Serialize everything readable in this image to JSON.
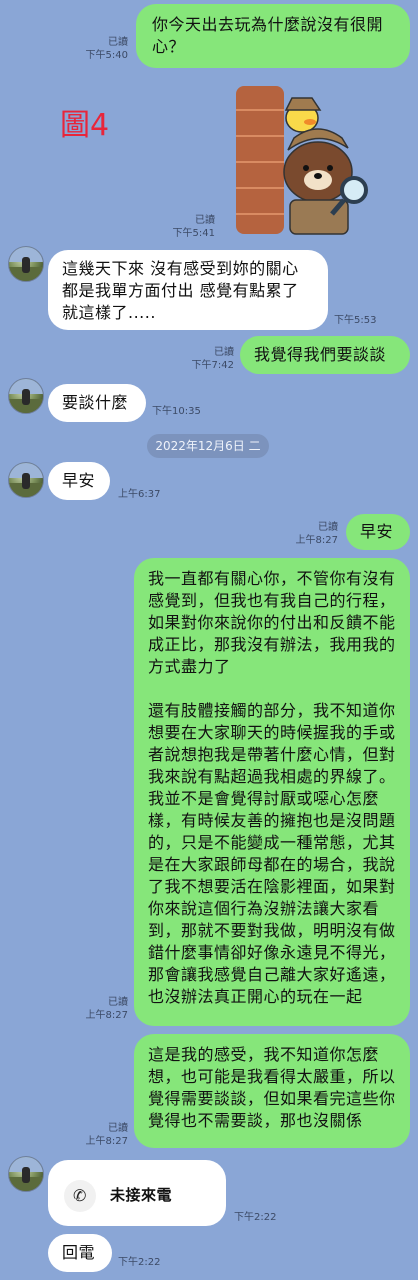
{
  "figure_label": "圖4",
  "date_separator": "2022年12月6日 二",
  "messages": [
    {
      "text": "你今天出去玩為什麼說沒有很開心？",
      "read": "已讀",
      "time": "下午5:40"
    },
    {
      "read": "已讀",
      "time": "下午5:41"
    },
    {
      "text": "這幾天下來 沒有感受到妳的關心\n都是我單方面付出 感覺有點累了\n就這樣了.....",
      "time": "下午5:53"
    },
    {
      "text": "我覺得我們要談談",
      "read": "已讀",
      "time": "下午7:42"
    },
    {
      "text": "要談什麼",
      "time": "下午10:35"
    },
    {
      "text": "早安",
      "time": "上午6:37"
    },
    {
      "text": "早安",
      "read": "已讀",
      "time": "上午8:27"
    },
    {
      "text": "我一直都有關心你，不管你有沒有感覺到，但我也有我自己的行程，如果對你來說你的付出和反饋不能成正比，那我沒有辦法，我用我的方式盡力了\n\n還有肢體接觸的部分，我不知道你想要在大家聊天的時候握我的手或者說想抱我是帶著什麼心情，但對我來說有點超過我相處的界線了。\n我並不是會覺得討厭或噁心怎麼樣，有時候友善的擁抱也是沒問題的，只是不能變成一種常態，尤其是在大家跟師母都在的場合，我說了我不想要活在陰影裡面，如果對你來說這個行為沒辦法讓大家看到，那就不要對我做，明明沒有做錯什麼事情卻好像永遠見不得光，那會讓我感覺自己離大家好遙遠，也沒辦法真正開心的玩在一起",
      "read": "已讀",
      "time": "上午8:27"
    },
    {
      "text": "這是我的感受，我不知道你怎麼想，也可能是我看得太嚴重，所以覺得需要談談，但如果看完這些你覺得也不需要談，那也沒關係",
      "read": "已讀",
      "time": "上午8:27"
    },
    {
      "text": "未接來電",
      "time": "下午2:22"
    },
    {
      "text": "回電",
      "time": "下午2:22"
    }
  ],
  "colors": {
    "background": "#8aa6d6",
    "outgoing": "#86e67a",
    "incoming": "#ffffff"
  },
  "icons": {
    "call": "phone-icon"
  }
}
